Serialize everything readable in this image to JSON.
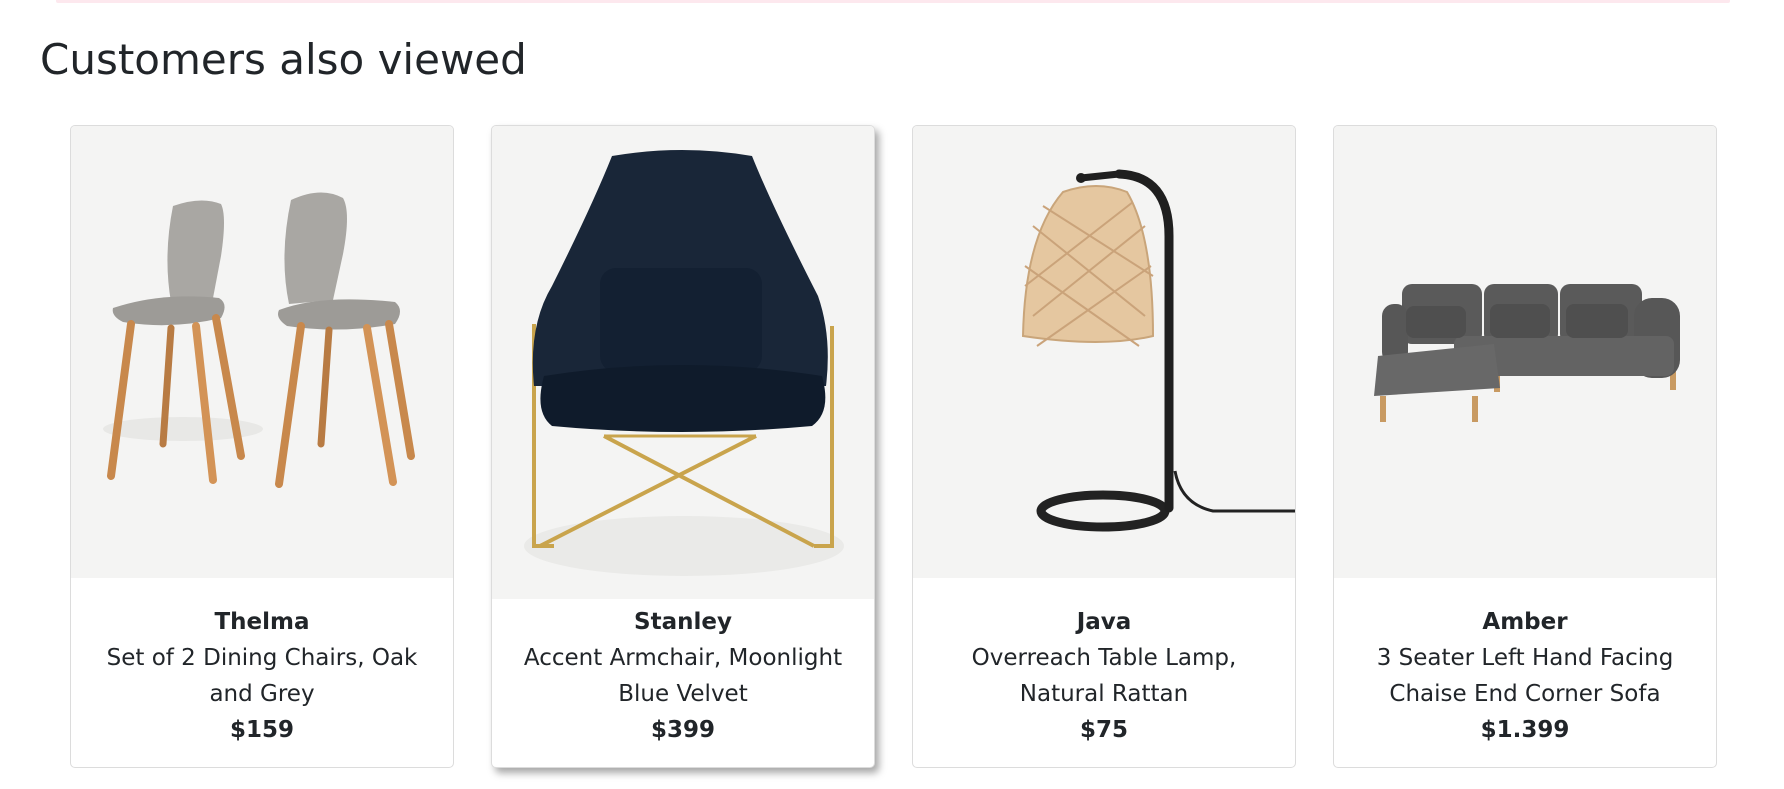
{
  "section": {
    "title": "Customers also viewed"
  },
  "products": [
    {
      "name": "Thelma",
      "description": "Set of 2 Dining Chairs, Oak and Grey",
      "price": "$159",
      "image_icon": "dining-chairs-image"
    },
    {
      "name": "Stanley",
      "description": "Accent Armchair, Moonlight Blue Velvet",
      "price": "$399",
      "image_icon": "armchair-image"
    },
    {
      "name": "Java",
      "description": "Overreach Table Lamp, Natural Rattan",
      "price": "$75",
      "image_icon": "table-lamp-image"
    },
    {
      "name": "Amber",
      "description": "3 Seater Left Hand Facing Chaise End Corner Sofa",
      "price": "$1.399",
      "image_icon": "corner-sofa-image"
    }
  ],
  "colors": {
    "image_background": "#f4f4f3",
    "card_border": "#dcdcdc",
    "text": "#212529",
    "top_strip": "#fde8ee"
  }
}
